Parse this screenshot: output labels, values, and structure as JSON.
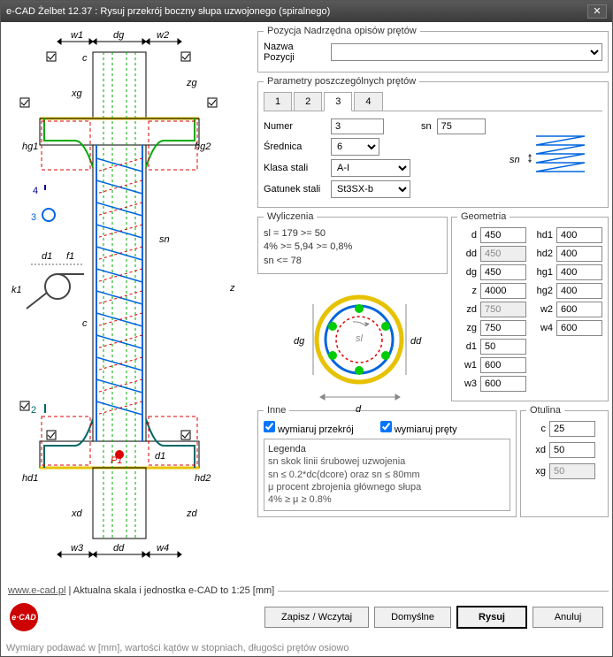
{
  "window": {
    "title": "e-CAD Żelbet 12.37 : Rysuj przekrój boczny słupa uzwojonego (spiralnego)"
  },
  "pos": {
    "legend": "Pozycja Nadrzędna opisów prętów",
    "label": "Nazwa Pozycji",
    "value": ""
  },
  "params": {
    "legend": "Parametry poszczególnych prętów",
    "tabs": [
      "1",
      "2",
      "3",
      "4"
    ],
    "active": "3",
    "numer_label": "Numer",
    "numer": "3",
    "srednica_label": "Średnica",
    "srednica": "6",
    "klasa_label": "Klasa stali",
    "klasa": "A-I",
    "gatunek_label": "Gatunek stali",
    "gatunek": "St3SX-b",
    "sn_label": "sn",
    "sn": "75"
  },
  "calc": {
    "legend": "Wyliczenia",
    "l1": "sl = 179 >= 50",
    "l2": "4% >= 5,94 >= 0,8%",
    "l3": "sn <= 78"
  },
  "geom": {
    "legend": "Geometria",
    "d": "450",
    "dd": "450",
    "dg": "450",
    "z": "4000",
    "zd": "750",
    "zg": "750",
    "d1": "50",
    "w1": "600",
    "w3": "600",
    "hd1": "400",
    "hd2": "400",
    "hg1": "400",
    "hg2": "400",
    "w2": "600",
    "w4": "600"
  },
  "inne": {
    "legend": "Inne",
    "cb1": "wymiaruj przekrój",
    "cb2": "wymiaruj pręty",
    "leg_title": "Legenda",
    "leg1": "sn   skok linii śrubowej uzwojenia",
    "leg2": "      sn ≤ 0.2*dc(dcore) oraz sn ≤ 80mm",
    "leg3": "μ    procent zbrojenia głównego słupa",
    "leg4": "      4% ≥ μ ≥ 0.8%"
  },
  "otulina": {
    "legend": "Otulina",
    "c": "25",
    "xd": "50",
    "xg": "50"
  },
  "footer": {
    "link": "www.e-cad.pl",
    "scale": "Aktualna skala i jednostka e-CAD to 1:25 [mm]",
    "btn_save": "Zapisz / Wczytaj",
    "btn_default": "Domyślne",
    "btn_draw": "Rysuj",
    "btn_cancel": "Anuluj",
    "status": "Wymiary podawać w [mm], wartości kątów w stopniach, długości prętów osiowo"
  },
  "drawing_labels": {
    "w1": "w1",
    "dg": "dg",
    "w2": "w2",
    "c": "c",
    "xg": "xg",
    "zg": "zg",
    "hg1": "hg1",
    "hg2": "hg2",
    "n4": "4",
    "n3": "3",
    "sn": "sn",
    "d1l": "d1",
    "f1": "f1",
    "k1": "k1",
    "n2": "2",
    "z": "z",
    "hd1": "hd1",
    "p1": "P1",
    "d1": "d1",
    "hd2": "hd2",
    "xd": "xd",
    "zd": "zd",
    "w3": "w3",
    "dd": "dd",
    "w4": "w4",
    "cs_dg": "dg",
    "cs_dd": "dd",
    "cs_d": "d",
    "cs_sl": "sl",
    "mini_sn": "sn"
  }
}
